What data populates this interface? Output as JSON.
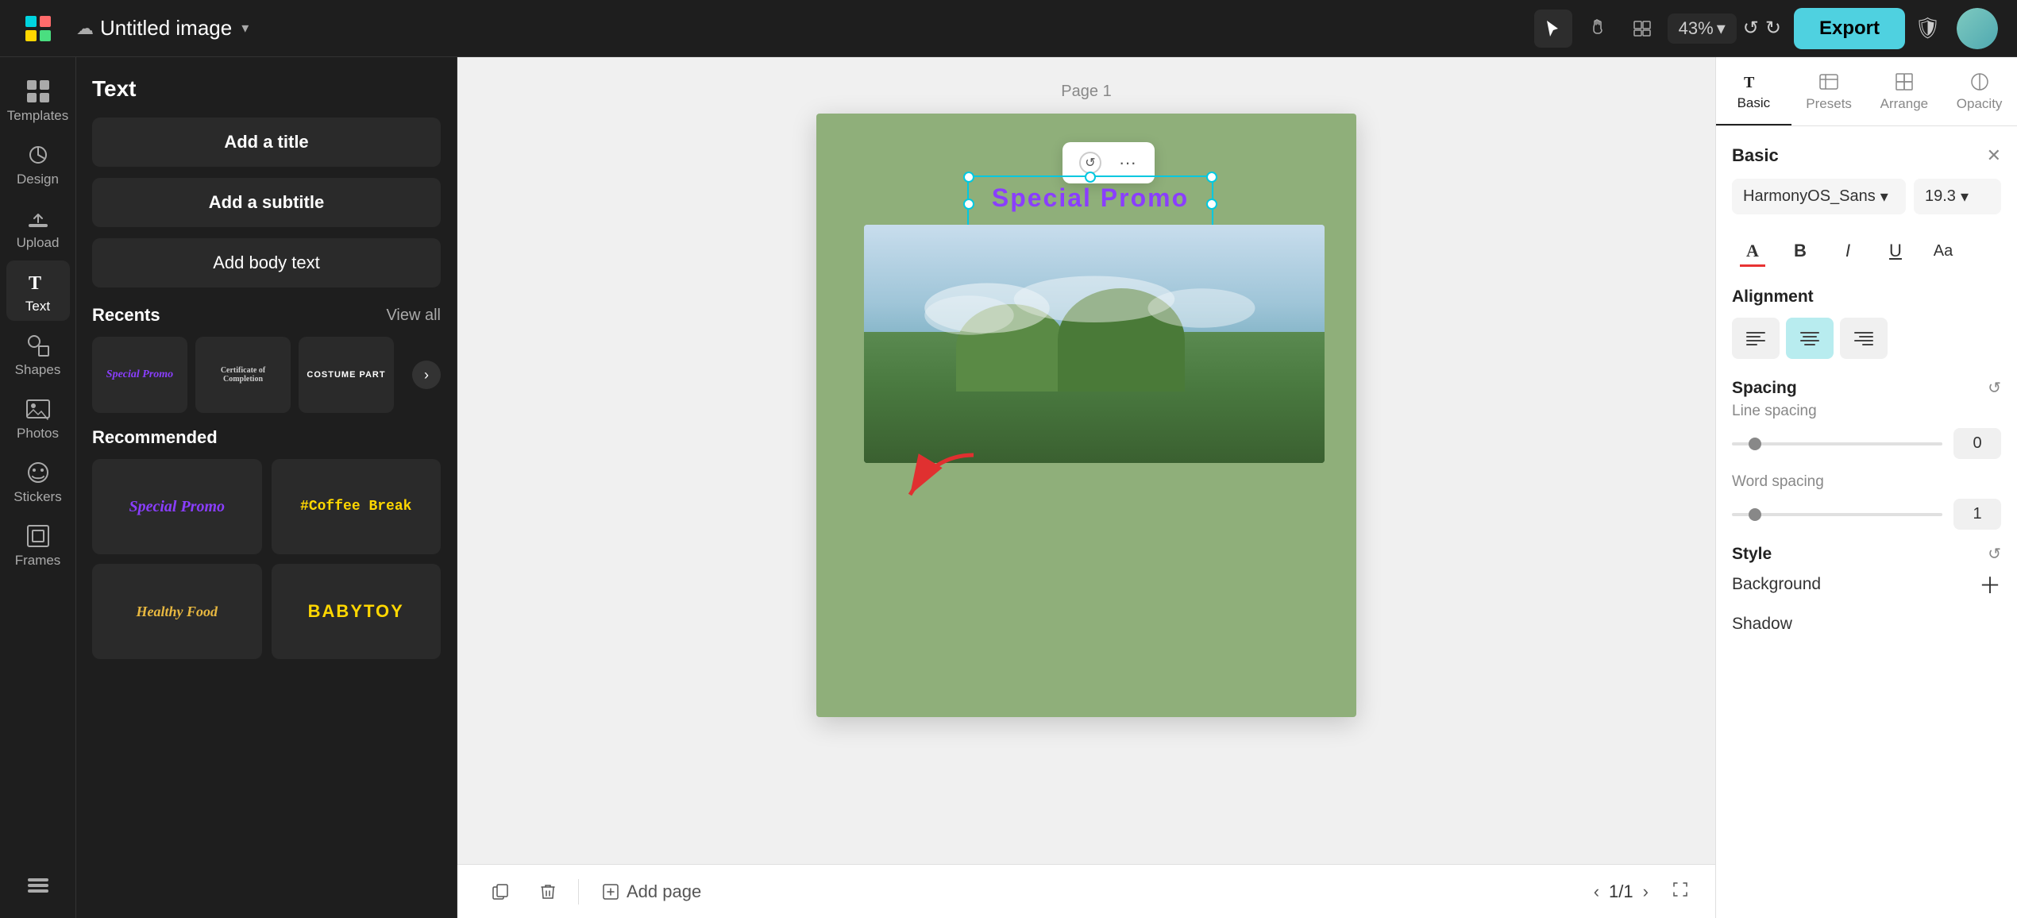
{
  "topbar": {
    "upload_icon": "☁",
    "title": "Untitled image",
    "chevron": "▾",
    "select_tool": "cursor",
    "hand_tool": "hand",
    "layout_tool": "layout",
    "zoom_level": "43%",
    "zoom_chevron": "▾",
    "undo": "↺",
    "redo": "↻",
    "export_label": "Export",
    "shield_icon": "🛡"
  },
  "icon_sidebar": {
    "items": [
      {
        "id": "templates",
        "icon": "grid",
        "label": "Templates"
      },
      {
        "id": "design",
        "icon": "design",
        "label": "Design"
      },
      {
        "id": "upload",
        "icon": "upload",
        "label": "Upload"
      },
      {
        "id": "text",
        "icon": "text",
        "label": "Text",
        "active": true
      },
      {
        "id": "shapes",
        "icon": "shapes",
        "label": "Shapes"
      },
      {
        "id": "photos",
        "icon": "photos",
        "label": "Photos"
      },
      {
        "id": "stickers",
        "icon": "stickers",
        "label": "Stickers"
      },
      {
        "id": "frames",
        "icon": "frames",
        "label": "Frames"
      },
      {
        "id": "more",
        "icon": "more",
        "label": ""
      }
    ]
  },
  "text_panel": {
    "title": "Text",
    "add_title_label": "Add a title",
    "add_subtitle_label": "Add a subtitle",
    "add_body_label": "Add body text",
    "recents_label": "Recents",
    "view_all_label": "View all",
    "recents": [
      {
        "id": "r1",
        "text": "Special Promo",
        "color": "#8a3eff",
        "style": "italic"
      },
      {
        "id": "r2",
        "text": "Certificate of Completion",
        "color": "#fff",
        "style": "normal"
      },
      {
        "id": "r3",
        "text": "COSTUME PART",
        "color": "#fff",
        "style": "normal"
      }
    ],
    "recommended_label": "Recommended",
    "recommended": [
      {
        "id": "rec1",
        "text": "Special Promo",
        "color": "#8a3eff",
        "style": "italic-serif"
      },
      {
        "id": "rec2",
        "text": "#Coffee Break",
        "color": "#ffd700",
        "style": "bold-mono"
      },
      {
        "id": "rec3",
        "text": "Healthy Food",
        "color": "#e8b840",
        "style": "italic-serif"
      },
      {
        "id": "rec4",
        "text": "BABYTOY",
        "color": "#ffd700",
        "style": "bold-block"
      }
    ]
  },
  "canvas": {
    "page_label": "Page 1",
    "text_content": "Special  Promo",
    "page_current": "1",
    "page_total": "1",
    "add_page_label": "Add page"
  },
  "right_panel": {
    "title": "Basic",
    "tabs": [
      {
        "id": "basic",
        "label": "Basic",
        "active": true
      },
      {
        "id": "presets",
        "label": "Presets"
      },
      {
        "id": "arrange",
        "label": "Arrange"
      },
      {
        "id": "opacity",
        "label": "Opacity"
      }
    ],
    "font_name": "HarmonyOS_Sans",
    "font_size": "19.3",
    "alignment_label": "Alignment",
    "align_options": [
      "left",
      "center",
      "right"
    ],
    "align_active": "center",
    "spacing_label": "Spacing",
    "line_spacing_label": "Line spacing",
    "line_spacing_value": "0",
    "word_spacing_label": "Word spacing",
    "word_spacing_value": "1",
    "style_label": "Style",
    "background_label": "Background",
    "shadow_label": "Shadow"
  }
}
